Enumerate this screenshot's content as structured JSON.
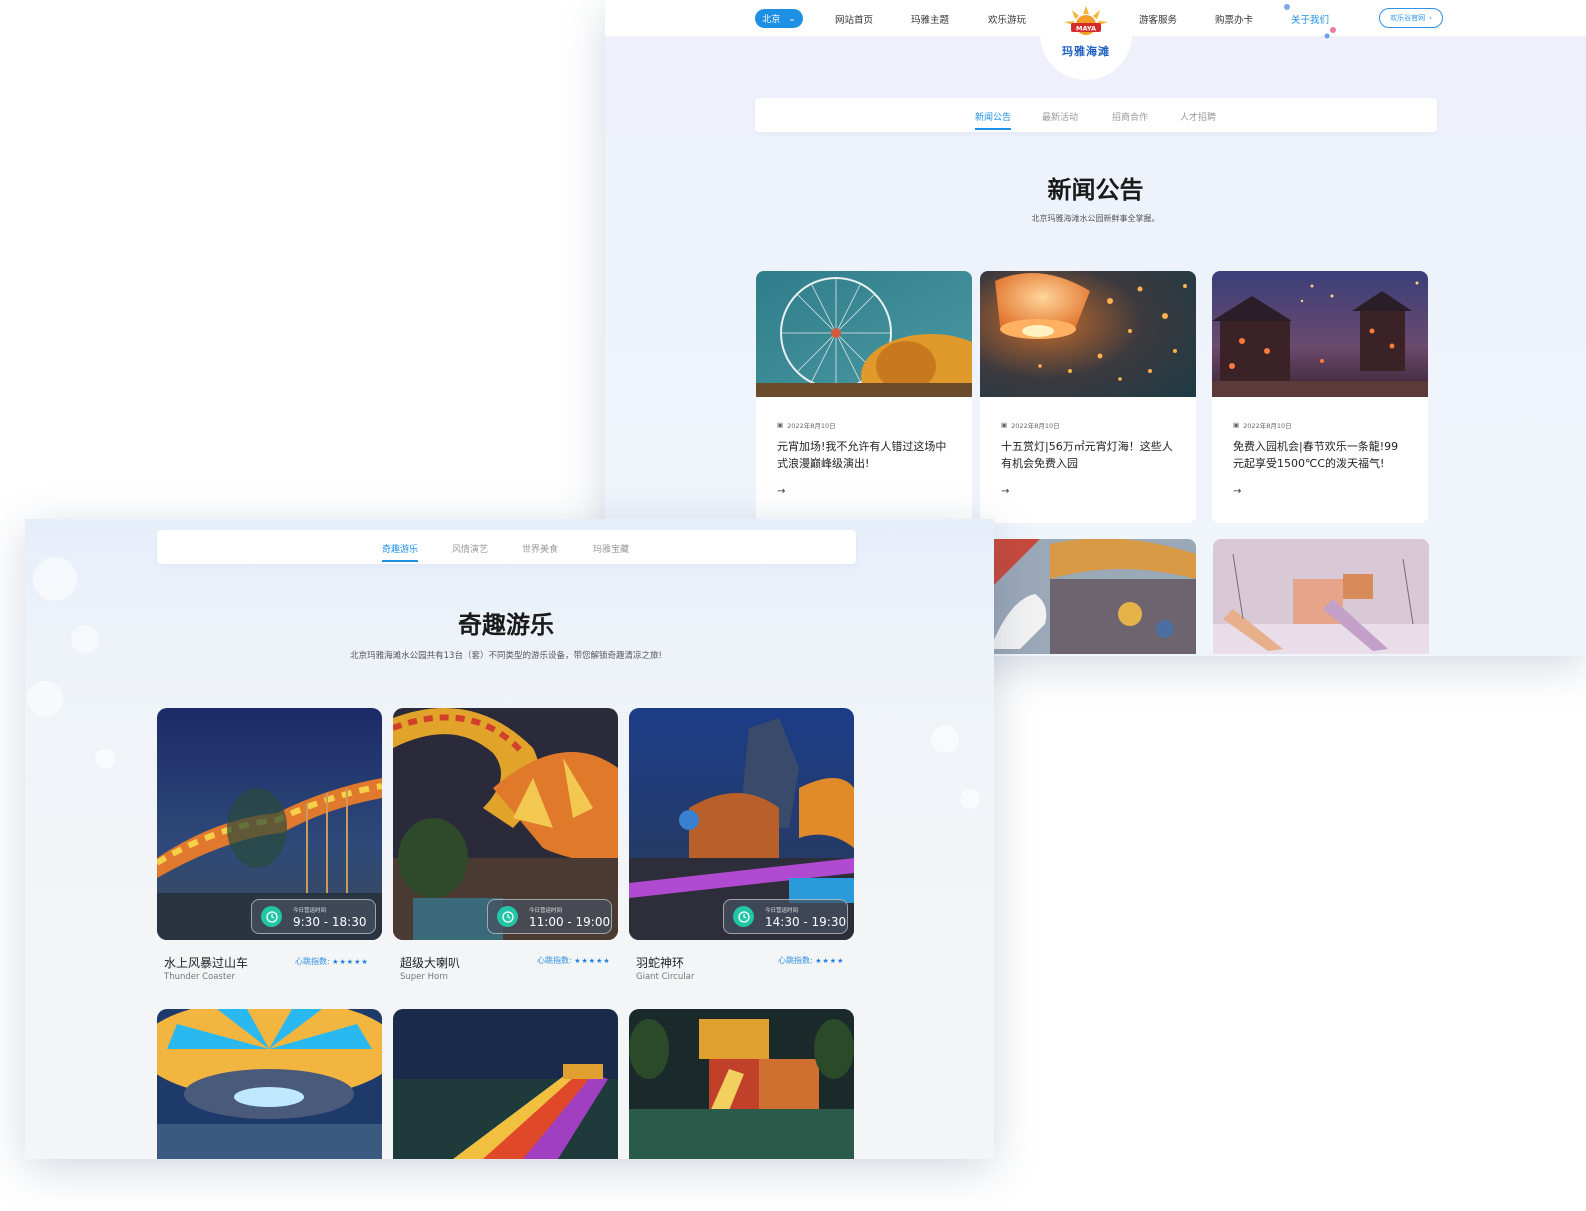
{
  "news_page": {
    "nav": {
      "city": "北京",
      "items": [
        "网站首页",
        "玛雅主题",
        "欢乐游玩",
        "游客服务",
        "购票办卡"
      ],
      "about": "关于我们",
      "brand_button": "欢乐谷官网"
    },
    "logo": {
      "small_text": "MAYA",
      "name": "玛雅海滩"
    },
    "tabs": [
      "新闻公告",
      "最新活动",
      "招商合作",
      "人才招聘"
    ],
    "active_tab": "新闻公告",
    "title": "新闻公告",
    "subtitle": "北京玛雅海滩水公园新鲜事全掌握。",
    "articles": [
      {
        "date": "2022年8月10日",
        "title": "元宵加场!我不允许有人错过这场中式浪漫巅峰级演出!"
      },
      {
        "date": "2022年8月10日",
        "title": "十五赏灯|56万㎡元宵灯海！这些人有机会免费入园"
      },
      {
        "date": "2022年8月10日",
        "title": "免费入园机会|春节欢乐一条龍!99元起享受1500℃C的泼天福气!"
      }
    ]
  },
  "rides_page": {
    "tabs": [
      "奇趣游乐",
      "风情演艺",
      "世界美食",
      "玛雅宝藏"
    ],
    "active_tab": "奇趣游乐",
    "title": "奇趣游乐",
    "subtitle": "北京玛雅海滩水公园共有13台（套）不同类型的游乐设备，带您解锁奇趣清凉之旅!",
    "hours_caption": "今日营运时间",
    "rating_label": "心跳指数:",
    "rides": [
      {
        "name": "水上风暴过山车",
        "en": "Thunder Coaster",
        "hours": "9:30 - 18:30",
        "stars": 5,
        "stars_text": "★★★★★"
      },
      {
        "name": "超级大喇叭",
        "en": "Super Horn",
        "hours": "11:00 - 19:00",
        "stars": 5,
        "stars_text": "★★★★★"
      },
      {
        "name": "羽蛇神环",
        "en": "Giant Circular",
        "hours": "14:30 - 19:30",
        "stars": 4,
        "stars_text": "★★★★"
      }
    ]
  },
  "colors": {
    "accent": "#1d8fe5",
    "clock": "#22c6a6"
  }
}
